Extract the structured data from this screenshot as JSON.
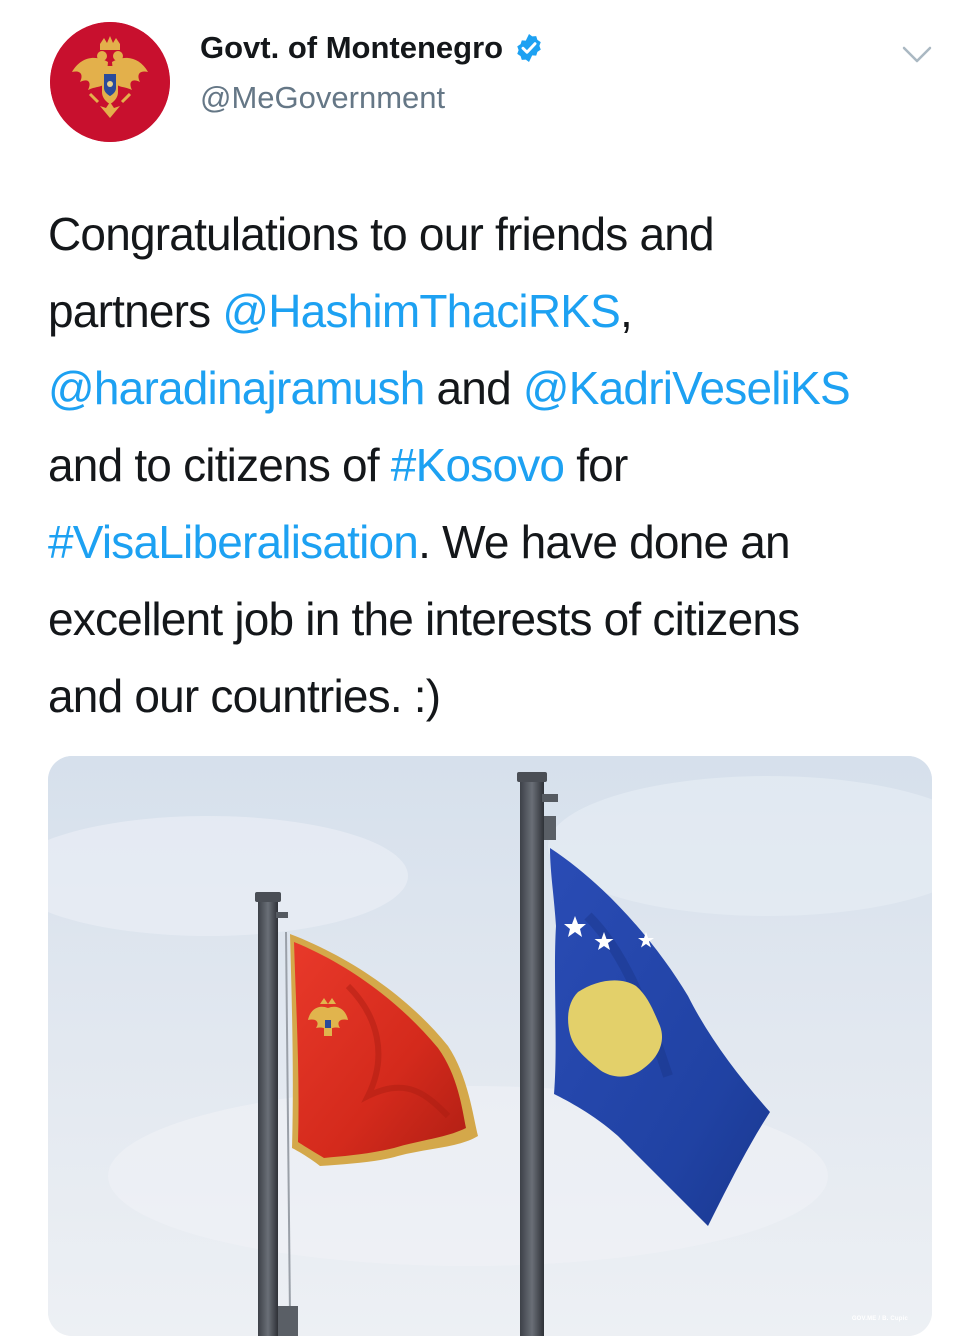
{
  "tweet": {
    "display_name": "Govt. of Montenegro",
    "handle": "@MeGovernment",
    "verified": true,
    "lines": [
      [
        {
          "text": "Congratulations to our friends and",
          "link": false
        }
      ],
      [
        {
          "text": "partners ",
          "link": false
        },
        {
          "text": "@HashimThaciRKS",
          "link": true
        },
        {
          "text": ",",
          "link": false
        }
      ],
      [
        {
          "text": "@haradinajramush",
          "link": true
        },
        {
          "text": " and ",
          "link": false
        },
        {
          "text": "@KadriVeseliKS",
          "link": true
        }
      ],
      [
        {
          "text": "and to citizens of ",
          "link": false
        },
        {
          "text": "#Kosovo",
          "link": true
        },
        {
          "text": " for",
          "link": false
        }
      ],
      [
        {
          "text": "#VisaLiberalisation",
          "link": true
        },
        {
          "text": ". We have done an",
          "link": false
        }
      ],
      [
        {
          "text": "excellent job in the interests of citizens",
          "link": false
        }
      ],
      [
        {
          "text": "and our countries. :)",
          "link": false
        }
      ]
    ],
    "media": {
      "photo_credit": "GOV.ME / B. Cupic"
    }
  },
  "icons": {
    "avatar": "montenegro-coat-of-arms-icon",
    "verified": "verified-badge-icon",
    "menu": "chevron-down-icon"
  },
  "colors": {
    "link": "#1da1f2",
    "text": "#14171a",
    "handle": "#657786",
    "avatar_bg": "#c8102e",
    "montenegro_flag_red": "#d62a1e",
    "montenegro_flag_gold": "#d4a84a",
    "kosovo_flag_blue": "#2344a8",
    "kosovo_map_yellow": "#e6d36b"
  }
}
